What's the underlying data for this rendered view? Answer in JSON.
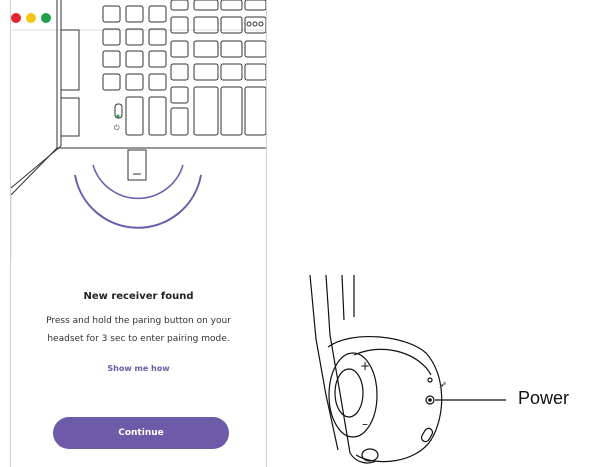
{
  "colors": {
    "accent": "#6d5aa8",
    "dot_red": "#e0262e",
    "dot_yellow": "#f5c518",
    "dot_green": "#1fa24a"
  },
  "window": {
    "icons": [
      "keyboard-illustration",
      "usb-receiver-illustration",
      "signal-arc"
    ]
  },
  "dialog": {
    "title": "New receiver found",
    "body_line1": "Press and hold the paring button on your",
    "body_line2": "headset for 3 sec to enter pairing mode.",
    "link": "Show me how",
    "button": "Continue"
  },
  "headset": {
    "plus": "+",
    "minus": "–",
    "label": "Power"
  }
}
